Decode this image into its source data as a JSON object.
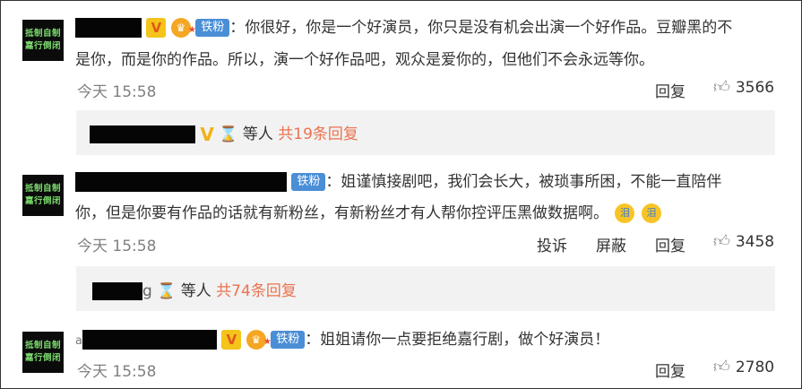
{
  "comments": [
    {
      "avatar_text": [
        "抵制自制",
        "嘉行倒闭"
      ],
      "fan_badge": "铁粉",
      "text_lines": [
        "：你很好，你是一个好演员，你只是没有机会出演一个好作品。豆瓣黑的不",
        "是你，而是你的作品。所以，演一个好作品吧，观众是爱你的，但他们不会永远等你。"
      ],
      "time": "今天 15:58",
      "actions": [
        "回复"
      ],
      "likes": "3566",
      "replies_summary": {
        "prefix": "等人",
        "count_text": "共19条回复"
      }
    },
    {
      "avatar_text": [
        "抵制自制",
        "嘉行倒闭"
      ],
      "fan_badge": "铁粉",
      "text_lines": [
        "：姐谨慎接剧吧，我们会长大，被琐事所困，不能一直陪伴",
        "你，但是你要有作品的话就有新粉丝，有新粉丝才有人帮你控评压黑做数据啊。"
      ],
      "emoji_label": "泪",
      "time": "今天 15:58",
      "actions": [
        "投诉",
        "屏蔽",
        "回复"
      ],
      "likes": "3458",
      "replies_summary": {
        "name_tail": "g",
        "prefix": "等人",
        "count_text": "共74条回复"
      }
    },
    {
      "avatar_text": [
        "抵制自制",
        "嘉行倒闭"
      ],
      "fan_badge": "铁粉",
      "name_lead": "a",
      "text_lines": [
        "：姐姐请你一点要拒绝嘉行剧，做个好演员！"
      ],
      "time": "今天 15:58",
      "actions": [
        "回复"
      ],
      "likes": "2780"
    }
  ],
  "icons": {
    "verified": "verified-v-icon",
    "level": "user-level-icon",
    "hourglass": "hourglass-icon",
    "like": "thumbs-up-icon"
  },
  "colors": {
    "fan_badge": "#4a8ed6",
    "reply_count": "#eb7350",
    "meta_gray": "#808080",
    "verified": "#f4c41a"
  }
}
